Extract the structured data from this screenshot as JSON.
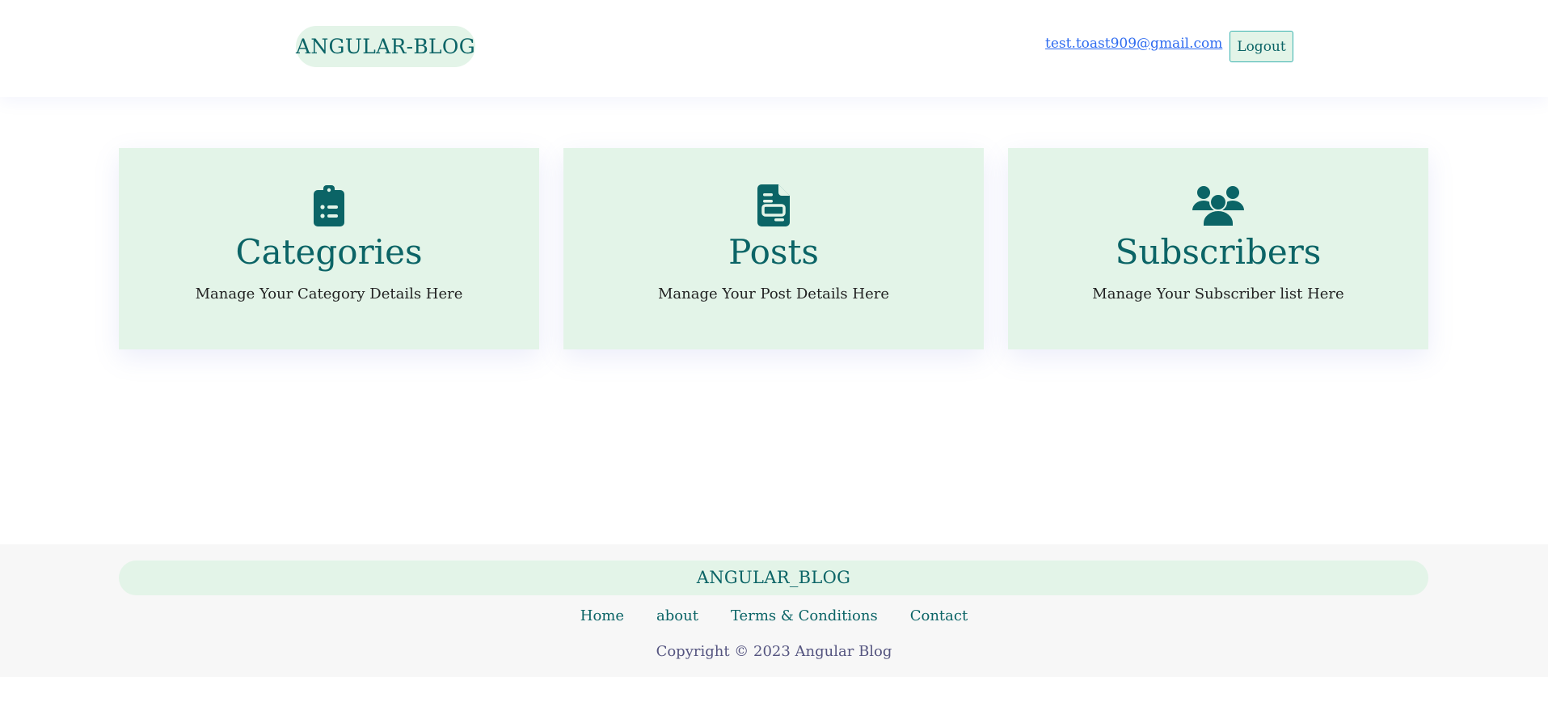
{
  "header": {
    "brand": "ANGULAR-BLOG",
    "user_email": "test.toast909@gmail.com",
    "logout_label": "Logout"
  },
  "cards": [
    {
      "icon": "clipboard-list-icon",
      "title": "Categories",
      "description": "Manage Your Category Details Here"
    },
    {
      "icon": "file-document-icon",
      "title": "Posts",
      "description": "Manage Your Post Details Here"
    },
    {
      "icon": "users-group-icon",
      "title": "Subscribers",
      "description": "Manage Your Subscriber list Here"
    }
  ],
  "footer": {
    "brand": "ANGULAR_BLOG",
    "links": [
      "Home",
      "about",
      "Terms & Conditions",
      "Contact"
    ],
    "copyright": "Copyright © 2023 Angular Blog"
  },
  "colors": {
    "accent": "#0b6466",
    "card_bg": "#e3f4e8",
    "link": "#2f6cf0",
    "footer_bg": "#f7f7f7"
  }
}
